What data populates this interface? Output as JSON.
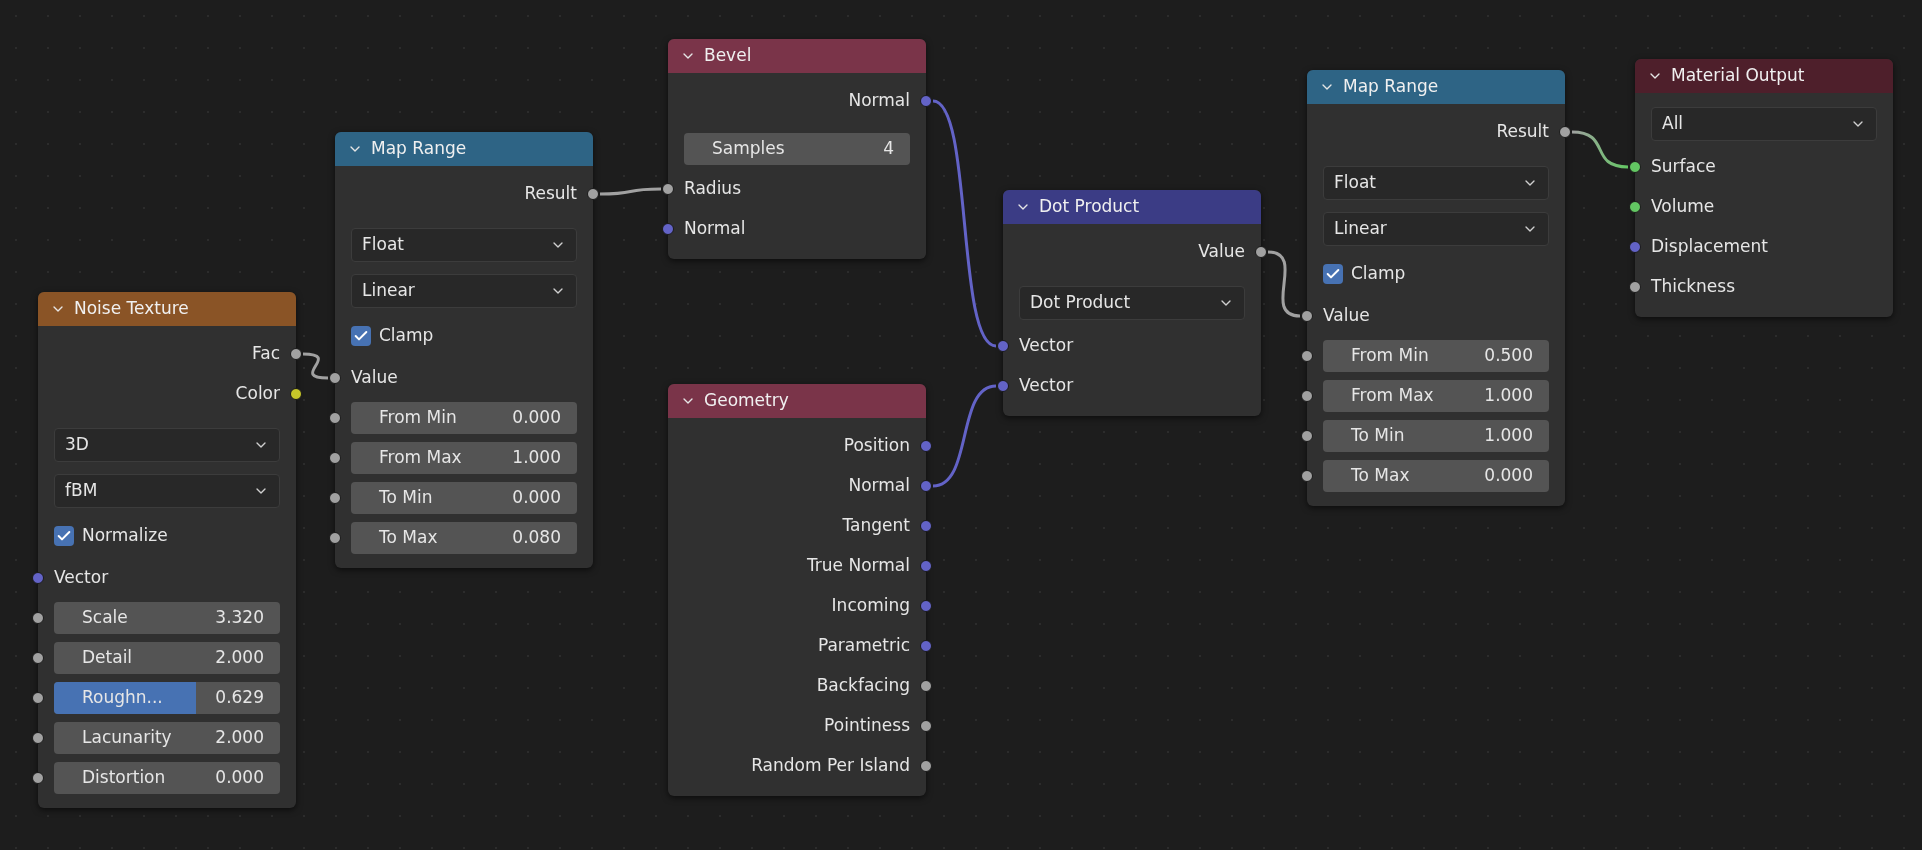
{
  "nodes": [
    {
      "title": "Noise Texture",
      "color": "#8a5426",
      "rows": [
        {
          "kind": "output",
          "label": "Fac",
          "color": "#a1a1a1"
        },
        {
          "kind": "output",
          "label": "Color",
          "color": "#c7c729"
        },
        {
          "kind": "dropdown",
          "label": "3D"
        },
        {
          "kind": "dropdown",
          "label": "fBM"
        },
        {
          "kind": "checkbox",
          "label": "Normalize",
          "checked": true
        },
        {
          "kind": "input",
          "label": "Vector",
          "color": "#6363c7"
        },
        {
          "kind": "field",
          "label": "Scale",
          "value": "3.320",
          "color": "#a1a1a1"
        },
        {
          "kind": "field",
          "label": "Detail",
          "value": "2.000",
          "color": "#a1a1a1"
        },
        {
          "kind": "field",
          "label": "Roughn...",
          "value": "0.629",
          "color": "#a1a1a1",
          "level": 0.629
        },
        {
          "kind": "field",
          "label": "Lacunarity",
          "value": "2.000",
          "color": "#a1a1a1"
        },
        {
          "kind": "field",
          "label": "Distortion",
          "value": "0.000",
          "color": "#a1a1a1"
        }
      ]
    },
    {
      "title": "Map Range",
      "color": "#2e6485",
      "rows": [
        {
          "kind": "output",
          "label": "Result",
          "color": "#a1a1a1"
        },
        {
          "kind": "dropdown",
          "label": "Float"
        },
        {
          "kind": "dropdown",
          "label": "Linear"
        },
        {
          "kind": "checkbox",
          "label": "Clamp",
          "checked": true
        },
        {
          "kind": "input",
          "label": "Value",
          "color": "#a1a1a1"
        },
        {
          "kind": "field",
          "label": "From Min",
          "value": "0.000",
          "color": "#a1a1a1"
        },
        {
          "kind": "field",
          "label": "From Max",
          "value": "1.000",
          "color": "#a1a1a1"
        },
        {
          "kind": "field",
          "label": "To Min",
          "value": "0.000",
          "color": "#a1a1a1"
        },
        {
          "kind": "field",
          "label": "To Max",
          "value": "0.080",
          "color": "#a1a1a1"
        }
      ]
    },
    {
      "title": "Bevel",
      "color": "#7a3449",
      "rows": [
        {
          "kind": "output",
          "label": "Normal",
          "color": "#6363c7"
        },
        {
          "kind": "field",
          "label": "Samples",
          "value": "4"
        },
        {
          "kind": "input",
          "label": "Radius",
          "color": "#a1a1a1"
        },
        {
          "kind": "input",
          "label": "Normal",
          "color": "#6363c7"
        }
      ]
    },
    {
      "title": "Geometry",
      "color": "#7a3449",
      "rows": [
        {
          "kind": "output",
          "label": "Position",
          "color": "#6363c7"
        },
        {
          "kind": "output",
          "label": "Normal",
          "color": "#6363c7"
        },
        {
          "kind": "output",
          "label": "Tangent",
          "color": "#6363c7"
        },
        {
          "kind": "output",
          "label": "True Normal",
          "color": "#6363c7"
        },
        {
          "kind": "output",
          "label": "Incoming",
          "color": "#6363c7"
        },
        {
          "kind": "output",
          "label": "Parametric",
          "color": "#6363c7"
        },
        {
          "kind": "output",
          "label": "Backfacing",
          "color": "#a1a1a1"
        },
        {
          "kind": "output",
          "label": "Pointiness",
          "color": "#a1a1a1"
        },
        {
          "kind": "output",
          "label": "Random Per Island",
          "color": "#a1a1a1"
        }
      ]
    },
    {
      "title": "Dot Product",
      "color": "#3b3c85",
      "rows": [
        {
          "kind": "output",
          "label": "Value",
          "color": "#a1a1a1"
        },
        {
          "kind": "dropdown",
          "label": "Dot Product"
        },
        {
          "kind": "input",
          "label": "Vector",
          "color": "#6363c7"
        },
        {
          "kind": "input",
          "label": "Vector",
          "color": "#6363c7"
        }
      ]
    },
    {
      "title": "Map Range",
      "color": "#2e6485",
      "rows": [
        {
          "kind": "output",
          "label": "Result",
          "color": "#a1a1a1"
        },
        {
          "kind": "dropdown",
          "label": "Float"
        },
        {
          "kind": "dropdown",
          "label": "Linear"
        },
        {
          "kind": "checkbox",
          "label": "Clamp",
          "checked": true
        },
        {
          "kind": "input",
          "label": "Value",
          "color": "#a1a1a1"
        },
        {
          "kind": "field",
          "label": "From Min",
          "value": "0.500",
          "color": "#a1a1a1"
        },
        {
          "kind": "field",
          "label": "From Max",
          "value": "1.000",
          "color": "#a1a1a1"
        },
        {
          "kind": "field",
          "label": "To Min",
          "value": "1.000",
          "color": "#a1a1a1"
        },
        {
          "kind": "field",
          "label": "To Max",
          "value": "0.000",
          "color": "#a1a1a1"
        }
      ]
    },
    {
      "title": "Material Output",
      "color": "#4e1f2b",
      "rows": [
        {
          "kind": "dropdown",
          "label": "All"
        },
        {
          "kind": "input",
          "label": "Surface",
          "color": "#63c763"
        },
        {
          "kind": "input",
          "label": "Volume",
          "color": "#63c763"
        },
        {
          "kind": "input",
          "label": "Displacement",
          "color": "#6363c7"
        },
        {
          "kind": "input",
          "label": "Thickness",
          "color": "#a1a1a1"
        }
      ]
    }
  ]
}
